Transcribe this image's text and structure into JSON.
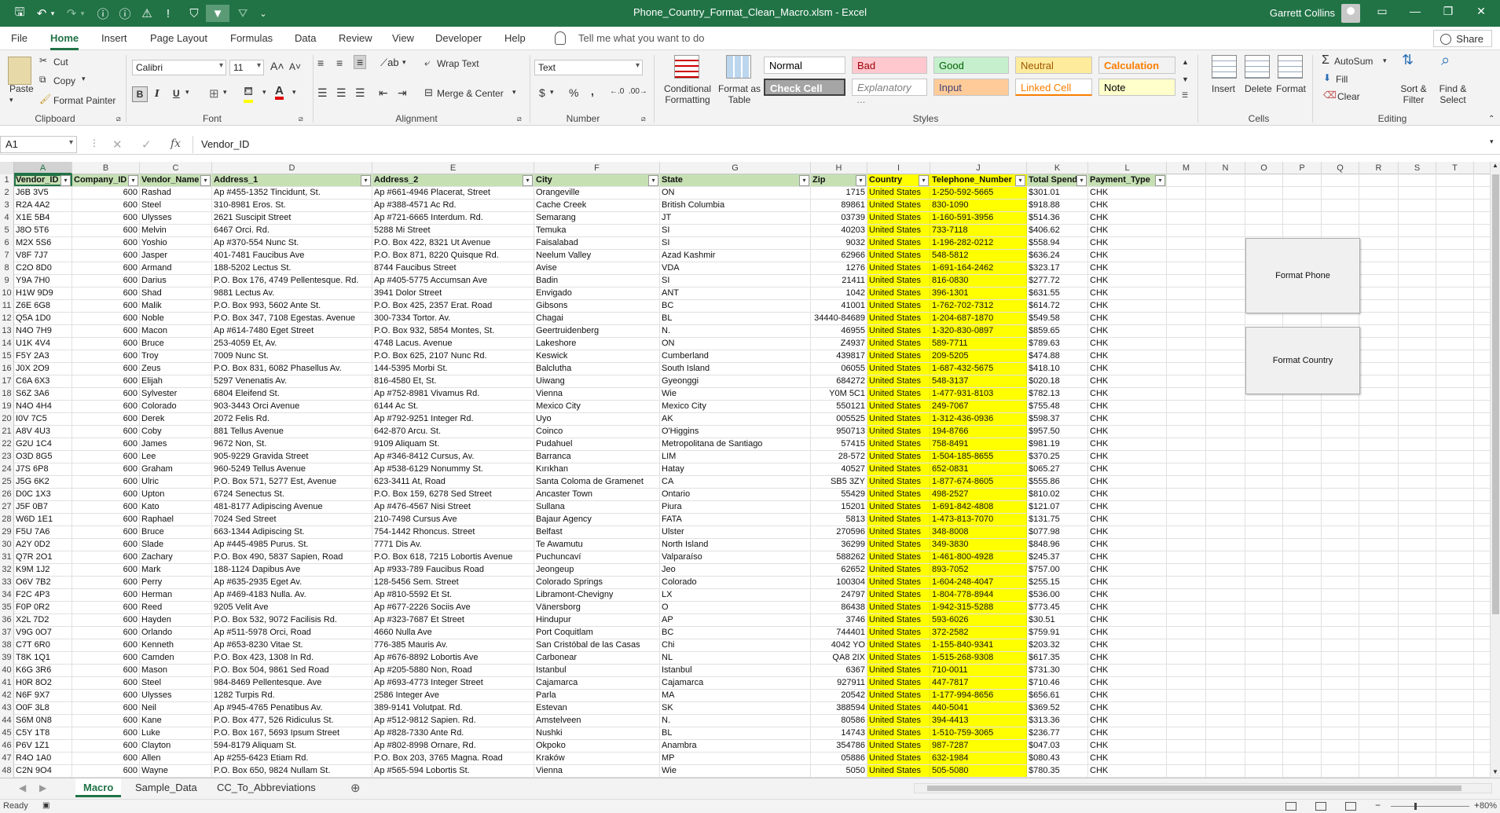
{
  "window": {
    "title": "Phone_Country_Format_Clean_Macro.xlsm - Excel",
    "user": "Garrett Collins"
  },
  "menu": {
    "tabs": [
      "File",
      "Home",
      "Insert",
      "Page Layout",
      "Formulas",
      "Data",
      "Review",
      "View",
      "Developer",
      "Help"
    ],
    "active": "Home",
    "tell_me": "Tell me what you want to do",
    "share": "Share"
  },
  "ribbon": {
    "clipboard": {
      "paste": "Paste",
      "cut": "Cut",
      "copy": "Copy",
      "format_painter": "Format Painter",
      "label": "Clipboard"
    },
    "font": {
      "name": "Calibri",
      "size": "11",
      "bold": "B",
      "italic": "I",
      "underline": "U",
      "label": "Font"
    },
    "alignment": {
      "wrap": "Wrap Text",
      "merge": "Merge & Center",
      "label": "Alignment"
    },
    "number": {
      "format": "Text",
      "currency": "$",
      "percent": "%",
      "comma": ",",
      "label": "Number"
    },
    "styles": {
      "conditional": "Conditional Formatting",
      "format_as_table": "Format as Table",
      "cells": [
        {
          "name": "Normal",
          "bg": "#ffffff",
          "fg": "#000000"
        },
        {
          "name": "Bad",
          "bg": "#ffc7ce",
          "fg": "#9c0006"
        },
        {
          "name": "Good",
          "bg": "#c6efce",
          "fg": "#006100"
        },
        {
          "name": "Neutral",
          "bg": "#ffeb9c",
          "fg": "#9c5700"
        },
        {
          "name": "Calculation",
          "bg": "#f2f2f2",
          "fg": "#fa7d00"
        },
        {
          "name": "Check Cell",
          "bg": "#a5a5a5",
          "fg": "#ffffff"
        },
        {
          "name": "Explanatory ...",
          "bg": "#ffffff",
          "fg": "#7f7f7f"
        },
        {
          "name": "Input",
          "bg": "#ffcc99",
          "fg": "#3f3f76"
        },
        {
          "name": "Linked Cell",
          "bg": "#ffffff",
          "fg": "#fa7d00"
        },
        {
          "name": "Note",
          "bg": "#ffffcc",
          "fg": "#000000"
        }
      ],
      "label": "Styles"
    },
    "cells": {
      "insert": "Insert",
      "delete": "Delete",
      "format": "Format",
      "label": "Cells"
    },
    "editing": {
      "autosum": "AutoSum",
      "fill": "Fill",
      "clear": "Clear",
      "sort": "Sort & Filter",
      "find": "Find & Select",
      "label": "Editing"
    }
  },
  "formula_bar": {
    "name_box": "A1",
    "fx": "fx",
    "value": "Vendor_ID"
  },
  "columns": [
    "A",
    "B",
    "C",
    "D",
    "E",
    "F",
    "G",
    "H",
    "I",
    "J",
    "K",
    "L",
    "M",
    "N",
    "O",
    "P",
    "Q",
    "R",
    "S",
    "T"
  ],
  "headers": [
    "Vendor_ID",
    "Company_ID",
    "Vendor_Name",
    "Address_1",
    "Address_2",
    "City",
    "State",
    "Zip",
    "Country",
    "Telephone_Number",
    "Total Spend",
    "Payment_Type"
  ],
  "rows": [
    [
      "J6B 3V5",
      "600",
      "Rashad",
      "Ap #455-1352 Tincidunt, St.",
      "Ap #661-4946 Placerat, Street",
      "Orangeville",
      "ON",
      "1715",
      "United States",
      "1-250-592-5665",
      "$301.01",
      "CHK"
    ],
    [
      "R2A 4A2",
      "600",
      "Steel",
      "310-8981 Eros. St.",
      "Ap #388-4571 Ac Rd.",
      "Cache Creek",
      "British Columbia",
      "89861",
      "United States",
      "830-1090",
      "$918.88",
      "CHK"
    ],
    [
      "X1E 5B4",
      "600",
      "Ulysses",
      "2621 Suscipit Street",
      "Ap #721-6665 Interdum. Rd.",
      "Semarang",
      "JT",
      "03739",
      "United States",
      "1-160-591-3956",
      "$514.36",
      "CHK"
    ],
    [
      "J8O 5T6",
      "600",
      "Melvin",
      "6467 Orci. Rd.",
      "5288 Mi Street",
      "Temuka",
      "SI",
      "40203",
      "United States",
      "733-7118",
      "$406.62",
      "CHK"
    ],
    [
      "M2X 5S6",
      "600",
      "Yoshio",
      "Ap #370-554 Nunc St.",
      "P.O. Box 422, 8321 Ut Avenue",
      "Faisalabad",
      "SI",
      "9032",
      "United States",
      "1-196-282-0212",
      "$558.94",
      "CHK"
    ],
    [
      "V8F 7J7",
      "600",
      "Jasper",
      "401-7481 Faucibus Ave",
      "P.O. Box 871, 8220 Quisque Rd.",
      "Neelum Valley",
      "Azad Kashmir",
      "62966",
      "United States",
      "548-5812",
      "$636.24",
      "CHK"
    ],
    [
      "C2O 8D0",
      "600",
      "Armand",
      "188-5202 Lectus St.",
      "8744 Faucibus Street",
      "Avise",
      "VDA",
      "1276",
      "United States",
      "1-691-164-2462",
      "$323.17",
      "CHK"
    ],
    [
      "Y9A 7H0",
      "600",
      "Darius",
      "P.O. Box 176, 4749 Pellentesque. Rd.",
      "Ap #405-5775 Accumsan Ave",
      "Badin",
      "SI",
      "21411",
      "United States",
      "816-0830",
      "$277.72",
      "CHK"
    ],
    [
      "H1W 9D9",
      "600",
      "Shad",
      "9881 Lectus Av.",
      "3941 Dolor Street",
      "Envigado",
      "ANT",
      "1042",
      "United States",
      "396-1301",
      "$631.55",
      "CHK"
    ],
    [
      "Z6E 6G8",
      "600",
      "Malik",
      "P.O. Box 993, 5602 Ante St.",
      "P.O. Box 425, 2357 Erat. Road",
      "Gibsons",
      "BC",
      "41001",
      "United States",
      "1-762-702-7312",
      "$614.72",
      "CHK"
    ],
    [
      "Q5A 1D0",
      "600",
      "Noble",
      "P.O. Box 347, 7108 Egestas. Avenue",
      "300-7334 Tortor. Av.",
      "Chagai",
      "BL",
      "34440-84689",
      "United States",
      "1-204-687-1870",
      "$549.58",
      "CHK"
    ],
    [
      "N4O 7H9",
      "600",
      "Macon",
      "Ap #614-7480 Eget Street",
      "P.O. Box 932, 5854 Montes, St.",
      "Geertruidenberg",
      "N.",
      "46955",
      "United States",
      "1-320-830-0897",
      "$859.65",
      "CHK"
    ],
    [
      "U1K 4V4",
      "600",
      "Bruce",
      "253-4059 Et, Av.",
      "4748 Lacus. Avenue",
      "Lakeshore",
      "ON",
      "Z4937",
      "United States",
      "589-7711",
      "$789.63",
      "CHK"
    ],
    [
      "F5Y 2A3",
      "600",
      "Troy",
      "7009 Nunc St.",
      "P.O. Box 625, 2107 Nunc Rd.",
      "Keswick",
      "Cumberland",
      "439817",
      "United States",
      "209-5205",
      "$474.88",
      "CHK"
    ],
    [
      "J0X 2O9",
      "600",
      "Zeus",
      "P.O. Box 831, 6082 Phasellus Av.",
      "144-5395 Morbi St.",
      "Balclutha",
      "South Island",
      "06055",
      "United States",
      "1-687-432-5675",
      "$418.10",
      "CHK"
    ],
    [
      "C6A 6X3",
      "600",
      "Elijah",
      "5297 Venenatis Av.",
      "816-4580 Et, St.",
      "Uiwang",
      "Gyeonggi",
      "684272",
      "United States",
      "548-3137",
      "$020.18",
      "CHK"
    ],
    [
      "S6Z 3A6",
      "600",
      "Sylvester",
      "6804 Eleifend St.",
      "Ap #752-8981 Vivamus Rd.",
      "Vienna",
      "Wie",
      "Y0M 5C1",
      "United States",
      "1-477-931-8103",
      "$782.13",
      "CHK"
    ],
    [
      "N4O 4H4",
      "600",
      "Colorado",
      "903-3443 Orci Avenue",
      "6144 Ac St.",
      "Mexico City",
      "Mexico City",
      "550121",
      "United States",
      "249-7067",
      "$755.48",
      "CHK"
    ],
    [
      "I0V 7C5",
      "600",
      "Derek",
      "2072 Felis Rd.",
      "Ap #792-9251 Integer Rd.",
      "Uyo",
      "AK",
      "005525",
      "United States",
      "1-312-436-0936",
      "$598.37",
      "CHK"
    ],
    [
      "A8V 4U3",
      "600",
      "Coby",
      "881 Tellus Avenue",
      "642-870 Arcu. St.",
      "Coinco",
      "O'Higgins",
      "950713",
      "United States",
      "194-8766",
      "$957.50",
      "CHK"
    ],
    [
      "G2U 1C4",
      "600",
      "James",
      "9672 Non, St.",
      "9109 Aliquam St.",
      "Pudahuel",
      "Metropolitana de Santiago",
      "57415",
      "United States",
      "758-8491",
      "$981.19",
      "CHK"
    ],
    [
      "O3D 8G5",
      "600",
      "Lee",
      "905-9229 Gravida Street",
      "Ap #346-8412 Cursus, Av.",
      "Barranca",
      "LIM",
      "28-572",
      "United States",
      "1-504-185-8655",
      "$370.25",
      "CHK"
    ],
    [
      "J7S 6P8",
      "600",
      "Graham",
      "960-5249 Tellus Avenue",
      "Ap #538-6129 Nonummy St.",
      "Kırıkhan",
      "Hatay",
      "40527",
      "United States",
      "652-0831",
      "$065.27",
      "CHK"
    ],
    [
      "J5G 6K2",
      "600",
      "Ulric",
      "P.O. Box 571, 5277 Est, Avenue",
      "623-3411 At, Road",
      "Santa Coloma de Gramenet",
      "CA",
      "SB5 3ZY",
      "United States",
      "1-877-674-8605",
      "$555.86",
      "CHK"
    ],
    [
      "D0C 1X3",
      "600",
      "Upton",
      "6724 Senectus St.",
      "P.O. Box 159, 6278 Sed Street",
      "Ancaster Town",
      "Ontario",
      "55429",
      "United States",
      "498-2527",
      "$810.02",
      "CHK"
    ],
    [
      "J5F 0B7",
      "600",
      "Kato",
      "481-8177 Adipiscing Avenue",
      "Ap #476-4567 Nisi Street",
      "Sullana",
      "Piura",
      "15201",
      "United States",
      "1-691-842-4808",
      "$121.07",
      "CHK"
    ],
    [
      "W6D 1E1",
      "600",
      "Raphael",
      "7024 Sed Street",
      "210-7498 Cursus Ave",
      "Bajaur Agency",
      "FATA",
      "5813",
      "United States",
      "1-473-813-7070",
      "$131.75",
      "CHK"
    ],
    [
      "F5U 7A6",
      "600",
      "Bruce",
      "663-1344 Adipiscing St.",
      "754-1442 Rhoncus. Street",
      "Belfast",
      "Ulster",
      "270596",
      "United States",
      "348-8008",
      "$077.98",
      "CHK"
    ],
    [
      "A2Y 0D2",
      "600",
      "Slade",
      "Ap #445-4985 Purus. St.",
      "7771 Dis Av.",
      "Te Awamutu",
      "North Island",
      "36299",
      "United States",
      "349-3830",
      "$848.96",
      "CHK"
    ],
    [
      "Q7R 2O1",
      "600",
      "Zachary",
      "P.O. Box 490, 5837 Sapien, Road",
      "P.O. Box 618, 7215 Lobortis Avenue",
      "Puchuncaví",
      "Valparaíso",
      "588262",
      "United States",
      "1-461-800-4928",
      "$245.37",
      "CHK"
    ],
    [
      "K9M 1J2",
      "600",
      "Mark",
      "188-1124 Dapibus Ave",
      "Ap #933-789 Faucibus Road",
      "Jeongeup",
      "Jeo",
      "62652",
      "United States",
      "893-7052",
      "$757.00",
      "CHK"
    ],
    [
      "O6V 7B2",
      "600",
      "Perry",
      "Ap #635-2935 Eget Av.",
      "128-5456 Sem. Street",
      "Colorado Springs",
      "Colorado",
      "100304",
      "United States",
      "1-604-248-4047",
      "$255.15",
      "CHK"
    ],
    [
      "F2C 4P3",
      "600",
      "Herman",
      "Ap #469-4183 Nulla. Av.",
      "Ap #810-5592 Et St.",
      "Libramont-Chevigny",
      "LX",
      "24797",
      "United States",
      "1-804-778-8944",
      "$536.00",
      "CHK"
    ],
    [
      "F0P 0R2",
      "600",
      "Reed",
      "9205 Velit Ave",
      "Ap #677-2226 Sociis Ave",
      "Vänersborg",
      "O",
      "86438",
      "United States",
      "1-942-315-5288",
      "$773.45",
      "CHK"
    ],
    [
      "X2L 7D2",
      "600",
      "Hayden",
      "P.O. Box 532, 9072 Facilisis Rd.",
      "Ap #323-7687 Et Street",
      "Hindupur",
      "AP",
      "3746",
      "United States",
      "593-6026",
      "$30.51",
      "CHK"
    ],
    [
      "V9G 0O7",
      "600",
      "Orlando",
      "Ap #511-5978 Orci, Road",
      "4660 Nulla Ave",
      "Port Coquitlam",
      "BC",
      "744401",
      "United States",
      "372-2582",
      "$759.91",
      "CHK"
    ],
    [
      "C7T 6R0",
      "600",
      "Kenneth",
      "Ap #653-8230 Vitae St.",
      "776-385 Mauris Av.",
      "San Cristóbal de las Casas",
      "Chi",
      "4042 YO",
      "United States",
      "1-155-840-9341",
      "$203.32",
      "CHK"
    ],
    [
      "T8K 1Q1",
      "600",
      "Camden",
      "P.O. Box 423, 1308 In Rd.",
      "Ap #676-8892 Lobortis Ave",
      "Carbonear",
      "NL",
      "QA8 2IX",
      "United States",
      "1-515-268-9308",
      "$617.35",
      "CHK"
    ],
    [
      "K6G 3R6",
      "600",
      "Mason",
      "P.O. Box 504, 9861 Sed Road",
      "Ap #205-5880 Non, Road",
      "Istanbul",
      "Istanbul",
      "6367",
      "United States",
      "710-0011",
      "$731.30",
      "CHK"
    ],
    [
      "H0R 8O2",
      "600",
      "Steel",
      "984-8469 Pellentesque. Ave",
      "Ap #693-4773 Integer Street",
      "Cajamarca",
      "Cajamarca",
      "927911",
      "United States",
      "447-7817",
      "$710.46",
      "CHK"
    ],
    [
      "N6F 9X7",
      "600",
      "Ulysses",
      "1282 Turpis Rd.",
      "2586 Integer Ave",
      "Parla",
      "MA",
      "20542",
      "United States",
      "1-177-994-8656",
      "$656.61",
      "CHK"
    ],
    [
      "O0F 3L8",
      "600",
      "Neil",
      "Ap #945-4765 Penatibus Av.",
      "389-9141 Volutpat. Rd.",
      "Estevan",
      "SK",
      "388594",
      "United States",
      "440-5041",
      "$369.52",
      "CHK"
    ],
    [
      "S6M 0N8",
      "600",
      "Kane",
      "P.O. Box 477, 526 Ridiculus St.",
      "Ap #512-9812 Sapien. Rd.",
      "Amstelveen",
      "N.",
      "80586",
      "United States",
      "394-4413",
      "$313.36",
      "CHK"
    ],
    [
      "C5Y 1T8",
      "600",
      "Luke",
      "P.O. Box 167, 5693 Ipsum Street",
      "Ap #828-7330 Ante Rd.",
      "Nushki",
      "BL",
      "14743",
      "United States",
      "1-510-759-3065",
      "$236.77",
      "CHK"
    ],
    [
      "P6V 1Z1",
      "600",
      "Clayton",
      "594-8179 Aliquam St.",
      "Ap #802-8998 Ornare, Rd.",
      "Okpoko",
      "Anambra",
      "354786",
      "United States",
      "987-7287",
      "$047.03",
      "CHK"
    ],
    [
      "R4O 1A0",
      "600",
      "Allen",
      "Ap #255-6423 Etiam Rd.",
      "P.O. Box 203, 3765 Magna. Road",
      "Kraków",
      "MP",
      "05886",
      "United States",
      "632-1984",
      "$080.43",
      "CHK"
    ],
    [
      "C2N 9O4",
      "600",
      "Wayne",
      "P.O. Box 650, 9824 Nullam St.",
      "Ap #565-594 Lobortis St.",
      "Vienna",
      "Wie",
      "5050",
      "United States",
      "505-5080",
      "$780.35",
      "CHK"
    ]
  ],
  "macro_buttons": {
    "format_phone": "Format Phone",
    "format_country": "Format Country"
  },
  "sheets": [
    "Macro",
    "Sample_Data",
    "CC_To_Abbreviations"
  ],
  "active_sheet": "Macro",
  "status": {
    "ready": "Ready",
    "zoom": "80%"
  },
  "colors": {
    "excel_green": "#217346",
    "highlight_yellow": "#ffff00",
    "header_green": "#c6e0b4"
  }
}
